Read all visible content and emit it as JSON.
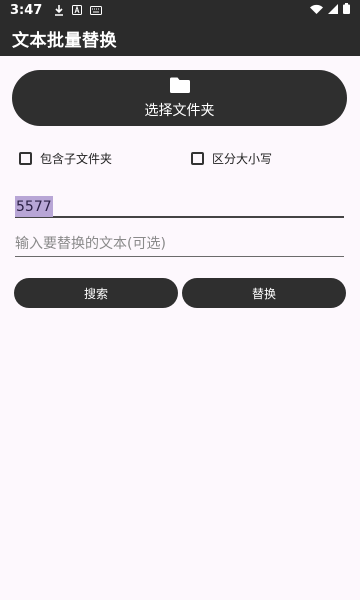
{
  "status_bar": {
    "time": "3:47",
    "icons": [
      "download-icon",
      "a-icon",
      "keyboard-icon",
      "wifi-icon",
      "signal-icon",
      "battery-icon"
    ]
  },
  "app_bar": {
    "title": "文本批量替换"
  },
  "folder_button": {
    "label": "选择文件夹",
    "icon": "folder-icon"
  },
  "options": {
    "include_subfolders": {
      "label": "包含子文件夹",
      "checked": false
    },
    "case_sensitive": {
      "label": "区分大小写",
      "checked": false
    }
  },
  "search_field": {
    "value": "5577"
  },
  "replace_field": {
    "placeholder": "输入要替换的文本(可选)",
    "value": ""
  },
  "buttons": {
    "search": "搜索",
    "replace": "替换"
  },
  "colors": {
    "bar": "#2b2b2b",
    "button": "#2f2f2f",
    "background": "#fdf8fd",
    "selection": "#b8a6d6"
  }
}
